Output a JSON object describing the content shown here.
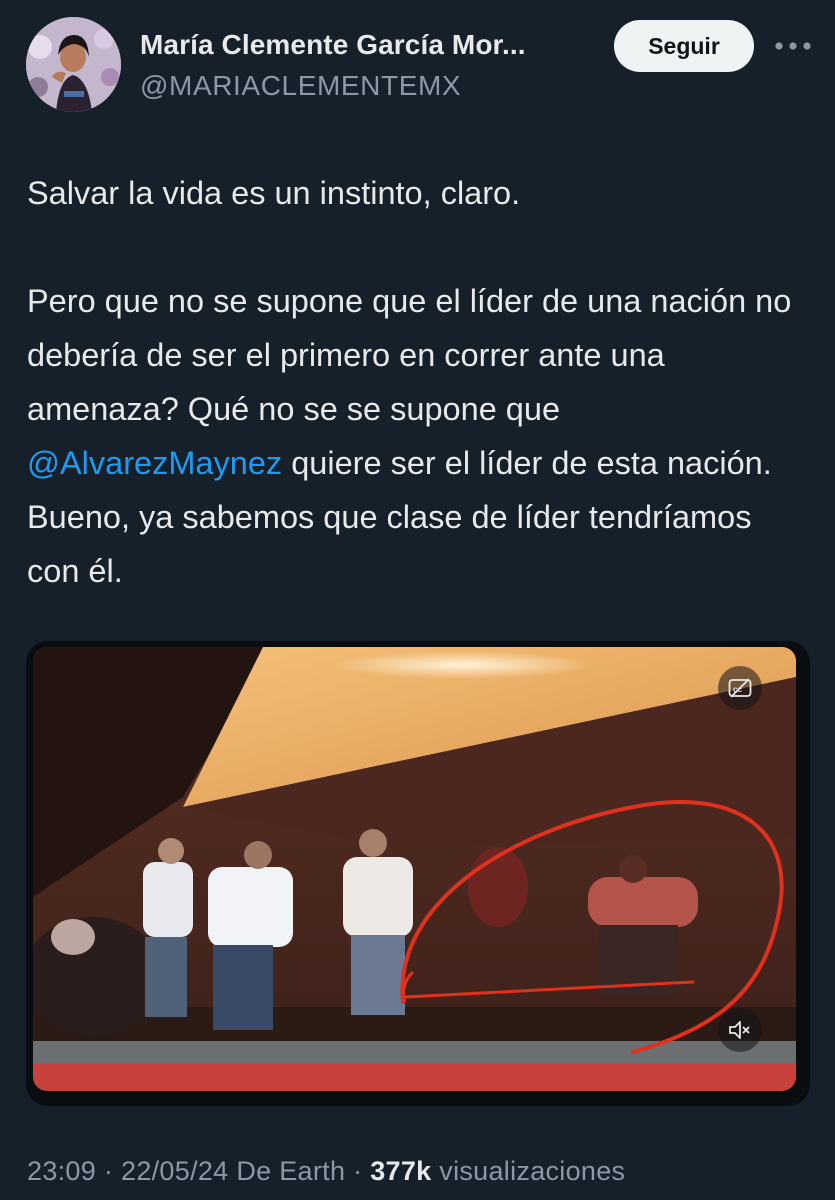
{
  "author": {
    "display_name": "María Clemente García Mor...",
    "handle": "@MARIACLEMENTEMX"
  },
  "actions": {
    "follow_label": "Seguir"
  },
  "tweet": {
    "paragraph1": "Salvar la vida es un instinto, claro.",
    "paragraph2_before": "Pero que no se supone que el líder de una nación no debería de ser el primero en correr ante una amenaza? Qué no se se supone que",
    "mention": "@AlvarezMaynez",
    "paragraph2_after": "quiere ser el líder de esta nación. Bueno, ya sabemos que clase de líder tendríamos con él."
  },
  "meta": {
    "time": "23:09",
    "sep1": "·",
    "date": "22/05/24",
    "source": "De Earth",
    "sep2": "·",
    "views_count": "377k",
    "views_label": "visualizaciones"
  },
  "colors": {
    "background": "#16202b",
    "text": "#e7e9ea",
    "secondary_text": "#8b98a5",
    "link": "#1d9bf0",
    "annotation_red": "#e0301e"
  },
  "icons": {
    "more": "more-dots-icon",
    "captions": "captions-icon",
    "mute": "volume-muted-icon"
  }
}
